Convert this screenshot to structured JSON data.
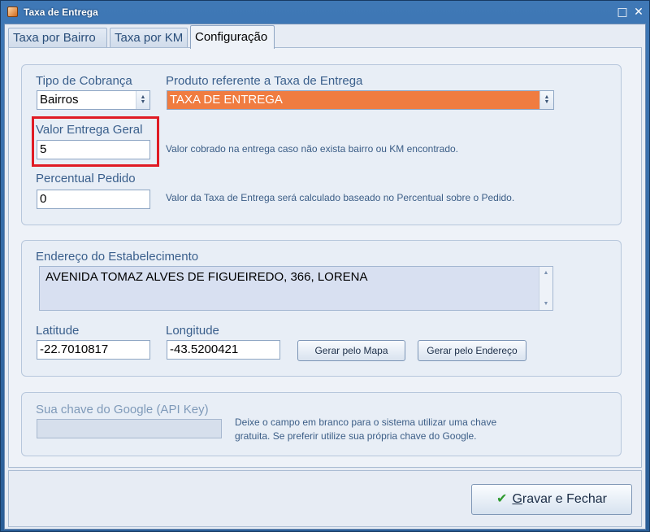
{
  "window": {
    "title": "Taxa de Entrega"
  },
  "tabs": [
    {
      "label": "Taxa por Bairro"
    },
    {
      "label": "Taxa por KM"
    },
    {
      "label": "Configuração"
    }
  ],
  "config": {
    "tipo_cobranca": {
      "label": "Tipo de Cobrança",
      "value": "Bairros"
    },
    "produto": {
      "label": "Produto referente a Taxa de Entrega",
      "value": "TAXA DE ENTREGA",
      "color": "#f07c40"
    },
    "valor_geral": {
      "label": "Valor Entrega Geral",
      "value": "5",
      "hint": "Valor cobrado na entrega caso não exista bairro ou KM encontrado."
    },
    "percentual": {
      "label": "Percentual Pedido",
      "value": "0",
      "hint": "Valor da Taxa de Entrega será calculado baseado no Percentual sobre o Pedido."
    }
  },
  "endereco": {
    "label": "Endereço do Estabelecimento",
    "value": "AVENIDA TOMAZ ALVES DE FIGUEIREDO, 366, LORENA",
    "latitude": {
      "label": "Latitude",
      "value": "-22.7010817"
    },
    "longitude": {
      "label": "Longitude",
      "value": "-43.5200421"
    },
    "btn_mapa": "Gerar pelo Mapa",
    "btn_endereco": "Gerar pelo Endereço"
  },
  "google": {
    "label": "Sua chave do Google (API Key)",
    "value": "",
    "hint_line1": "Deixe o campo em branco para o sistema utilizar uma chave",
    "hint_line2": "gratuita. Se preferir utilize sua própria chave do Google."
  },
  "footer": {
    "save_mnemonic": "G",
    "save_rest": "ravar e Fechar"
  },
  "colors": {
    "highlight": "#e01b24",
    "accent": "#2a5e97"
  },
  "icons": {
    "window": "app-icon",
    "save": "check-icon"
  }
}
